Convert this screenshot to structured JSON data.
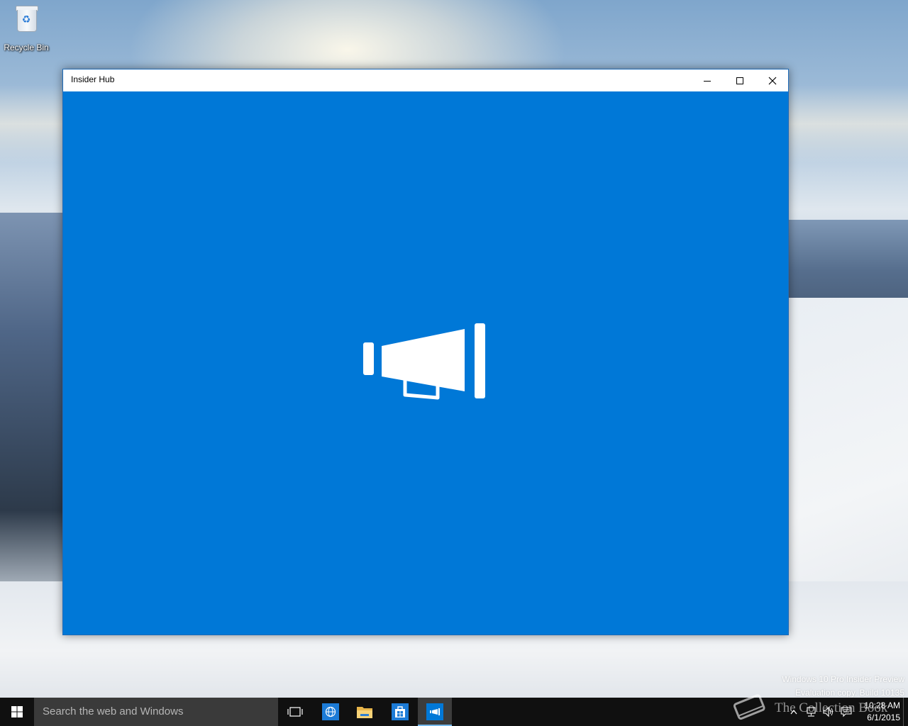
{
  "desktop": {
    "icons": [
      {
        "label": "Recycle Bin",
        "icon": "recycle-bin-icon"
      }
    ],
    "watermark": {
      "line1": "Windows 10 Pro Insider Preview",
      "line2": "Evaluation copy. Build 10135"
    },
    "overlay_text": "The Collection Book"
  },
  "window": {
    "title": "Insider Hub",
    "buttons": {
      "minimize": "minimize-icon",
      "maximize": "maximize-icon",
      "close": "close-icon"
    },
    "background": "#0078d7",
    "splash_icon": "megaphone-icon"
  },
  "taskbar": {
    "background": "#101010",
    "search_placeholder": "Search the web and Windows",
    "buttons": [
      {
        "name": "task-view",
        "icon": "task-view-icon"
      },
      {
        "name": "edge",
        "icon": "globe-icon"
      },
      {
        "name": "file-explorer",
        "icon": "folder-icon"
      },
      {
        "name": "store",
        "icon": "store-icon"
      },
      {
        "name": "insider-hub",
        "icon": "megaphone-icon",
        "active": true
      }
    ],
    "tray": {
      "time": "10:28 AM",
      "date": "6/1/2015"
    }
  }
}
